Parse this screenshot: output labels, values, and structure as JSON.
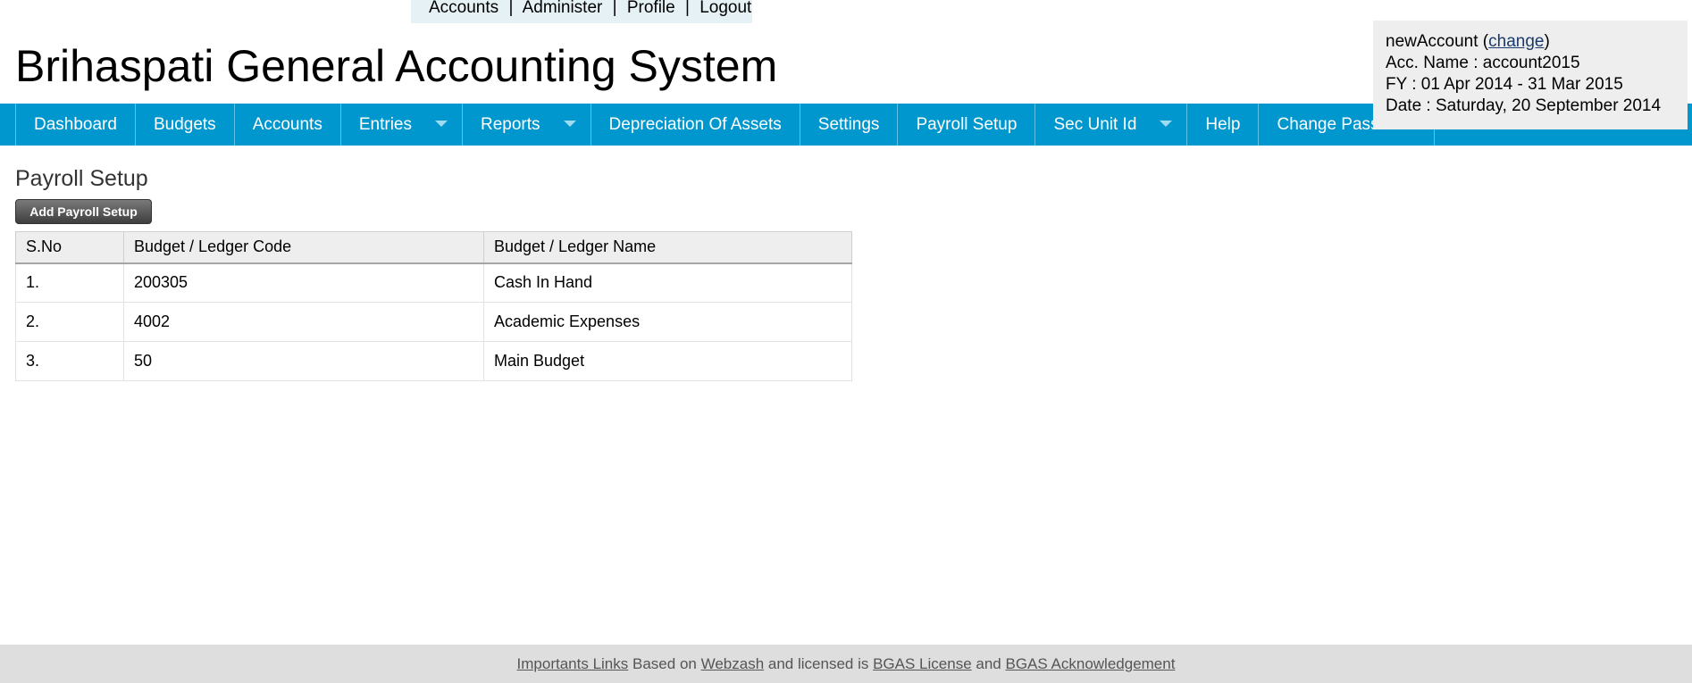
{
  "top_links": {
    "accounts": "Accounts",
    "administer": "Administer",
    "profile": "Profile",
    "logout": "Logout",
    "separator": "|"
  },
  "header": {
    "title": "Brihaspati General Accounting System"
  },
  "account_info": {
    "account": "newAccount",
    "change_label": "change",
    "acc_name": "Acc. Name : account2015",
    "fy": "FY : 01 Apr 2014 - 31 Mar 2015",
    "date": "Date : Saturday, 20 September 2014"
  },
  "nav": {
    "items": [
      {
        "label": "Dashboard"
      },
      {
        "label": "Budgets"
      },
      {
        "label": "Accounts"
      },
      {
        "label": "Entries"
      },
      {
        "label": "Reports"
      },
      {
        "label": "Depreciation Of Assets"
      },
      {
        "label": "Settings"
      },
      {
        "label": "Payroll Setup"
      },
      {
        "label": "Sec Unit Id"
      },
      {
        "label": "Help"
      },
      {
        "label": "Change Password"
      }
    ]
  },
  "main": {
    "heading": "Payroll Setup",
    "add_button": "Add Payroll Setup",
    "table": {
      "headers": [
        "S.No",
        "Budget / Ledger Code",
        "Budget / Ledger Name"
      ],
      "rows": [
        [
          "1.",
          "200305",
          "Cash In Hand"
        ],
        [
          "2.",
          "4002",
          "Academic Expenses"
        ],
        [
          "3.",
          "50",
          "Main Budget"
        ]
      ]
    }
  },
  "footer": {
    "important_links": "Importants Links",
    "based_on": "Based on",
    "webzash": "Webzash",
    "licensed": "and licensed is",
    "license": "BGAS License",
    "and": "and",
    "acknowledgement": "BGAS Acknowledgement"
  },
  "colors": {
    "nav_bg": "#0097cf",
    "footer_bg": "#dedede",
    "account_box_bg": "#eeeeee"
  }
}
